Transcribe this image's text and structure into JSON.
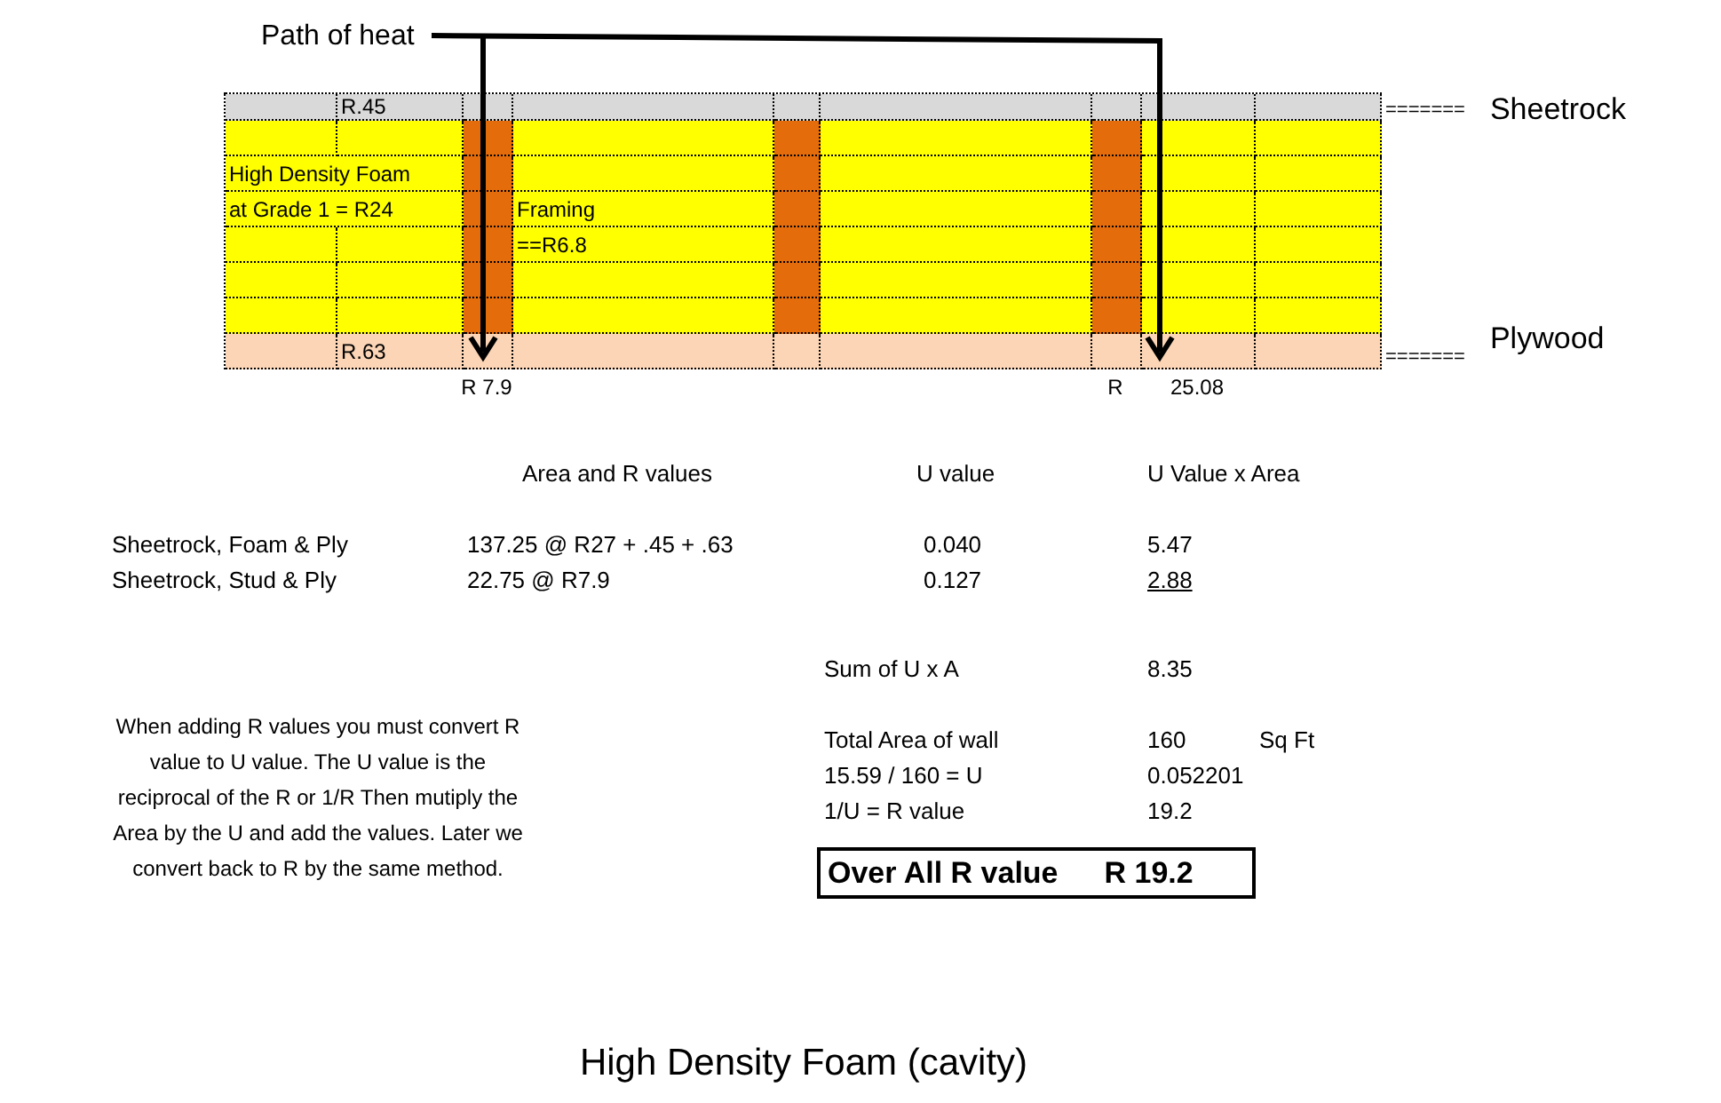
{
  "heading": "Path of heat",
  "wall": {
    "columns": [
      {
        "kind": "cavity"
      },
      {
        "kind": "cavity"
      },
      {
        "kind": "stud"
      },
      {
        "kind": "cavity"
      },
      {
        "kind": "stud"
      },
      {
        "kind": "cavity"
      },
      {
        "kind": "stud"
      },
      {
        "kind": "cavity"
      },
      {
        "kind": "cavity"
      }
    ],
    "rows": [
      {
        "kind": "sheetrock",
        "labels": [
          "R.45"
        ]
      },
      {
        "kind": "foam"
      },
      {
        "kind": "foam",
        "labels": [
          "High Density Foam"
        ]
      },
      {
        "kind": "foam",
        "labels": [
          "at Grade 1 = R24",
          "Framing"
        ]
      },
      {
        "kind": "foam",
        "labels": [
          "==R6.8"
        ]
      },
      {
        "kind": "foam"
      },
      {
        "kind": "foam"
      },
      {
        "kind": "plywood",
        "labels": [
          "R.63"
        ]
      }
    ],
    "side_labels": [
      {
        "marker": "=======",
        "label": "Sheetrock"
      },
      {
        "marker": "=======",
        "label": "Plywood"
      }
    ],
    "readings": [
      "R 7.9",
      "R",
      "25.08"
    ]
  },
  "table": {
    "columns": [
      "Area and R values",
      "U value",
      "U Value x Area"
    ],
    "rows": [
      {
        "label": "Sheetrock, Foam & Ply",
        "area": "137.25 @ R27 + .45 + .63",
        "u_value": "0.040",
        "u_x_area": "5.47",
        "underlined": false
      },
      {
        "label": "Sheetrock, Stud & Ply",
        "area": "22.75 @ R7.9",
        "u_value": "0.127",
        "u_x_area": "2.88",
        "underlined": true
      }
    ]
  },
  "note": "When adding R values you must convert R value to U value. The U value is the reciprocal of the R or 1/R Then mutiply the Area by the U and add the values. Later we convert back to R by the same method.",
  "calculations": [
    [
      {
        "label": "Sum of U x A",
        "value": "8.35"
      }
    ],
    [
      {
        "label": "Total Area of wall",
        "value": "160",
        "unit": "Sq Ft"
      },
      {
        "label": "15.59 / 160 = U",
        "value": "0.052201"
      },
      {
        "label": "1/U = R value",
        "value": "19.2"
      }
    ]
  ],
  "result": {
    "label": "Over All R value",
    "value": "R 19.2"
  },
  "caption": "High Density Foam (cavity)"
}
